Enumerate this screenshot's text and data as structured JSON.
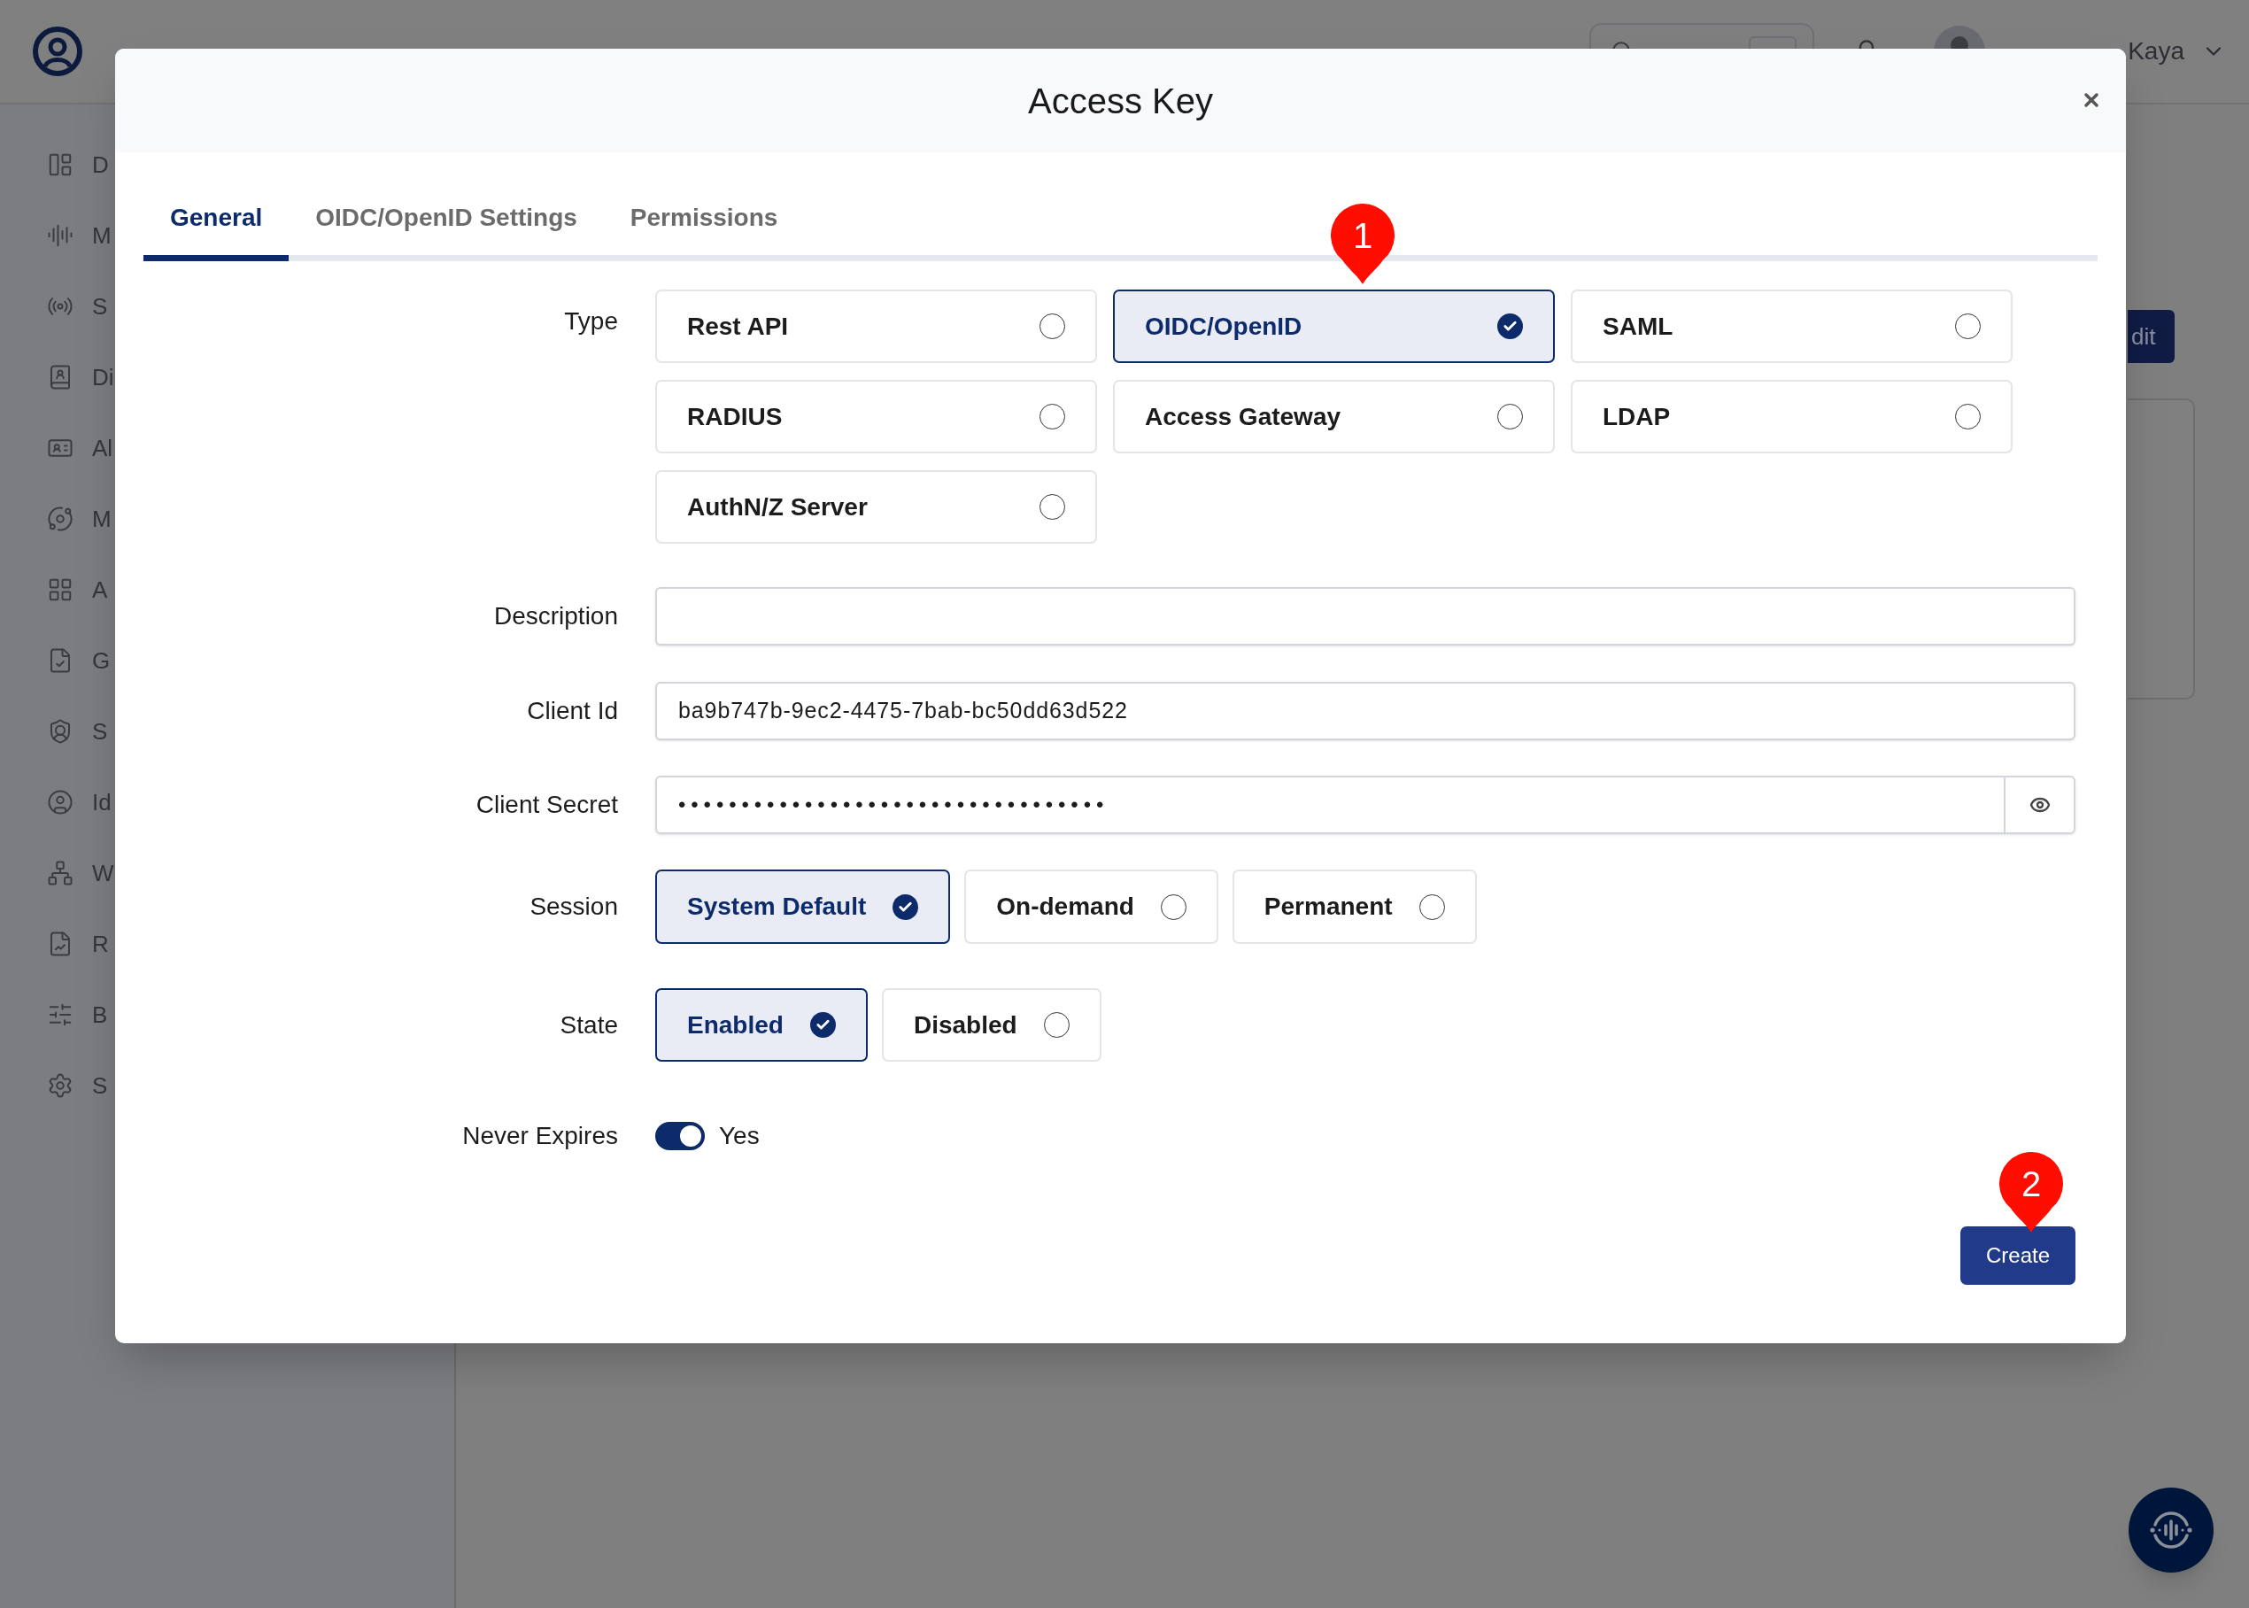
{
  "app_header": {
    "user_name": "Kaya"
  },
  "sidebar": {
    "items": [
      {
        "label": "D"
      },
      {
        "label": "M"
      },
      {
        "label": "S"
      },
      {
        "label": "Di"
      },
      {
        "label": "Al"
      },
      {
        "label": "M"
      },
      {
        "label": "A"
      },
      {
        "label": "G"
      },
      {
        "label": "S"
      },
      {
        "label": "Id"
      },
      {
        "label": "W"
      },
      {
        "label": "R"
      },
      {
        "label": "B"
      },
      {
        "label": "S"
      }
    ]
  },
  "page": {
    "action_button": "dit"
  },
  "dialog": {
    "title": "Access Key",
    "tabs": [
      {
        "label": "General",
        "selected": true
      },
      {
        "label": "OIDC/OpenID Settings",
        "selected": false
      },
      {
        "label": "Permissions",
        "selected": false
      }
    ],
    "form": {
      "type": {
        "label": "Type",
        "options": [
          {
            "label": "Rest API",
            "selected": false
          },
          {
            "label": "OIDC/OpenID",
            "selected": true
          },
          {
            "label": "SAML",
            "selected": false
          },
          {
            "label": "RADIUS",
            "selected": false
          },
          {
            "label": "Access Gateway",
            "selected": false
          },
          {
            "label": "LDAP",
            "selected": false
          },
          {
            "label": "AuthN/Z Server",
            "selected": false
          }
        ]
      },
      "description": {
        "label": "Description"
      },
      "client_id": {
        "label": "Client Id",
        "value": "ba9b747b-9ec2-4475-7bab-bc50dd63d522"
      },
      "client_secret": {
        "label": "Client Secret",
        "value": "••••••••••••••••••••••••••••••••••"
      },
      "session": {
        "label": "Session",
        "options": [
          {
            "label": "System Default",
            "selected": true
          },
          {
            "label": "On-demand",
            "selected": false
          },
          {
            "label": "Permanent",
            "selected": false
          }
        ]
      },
      "state": {
        "label": "State",
        "options": [
          {
            "label": "Enabled",
            "selected": true
          },
          {
            "label": "Disabled",
            "selected": false
          }
        ]
      },
      "never_expires": {
        "label": "Never Expires",
        "on": true,
        "value_label": "Yes"
      }
    },
    "create_button": "Create"
  },
  "annotations": [
    {
      "label": "1"
    },
    {
      "label": "2"
    }
  ]
}
